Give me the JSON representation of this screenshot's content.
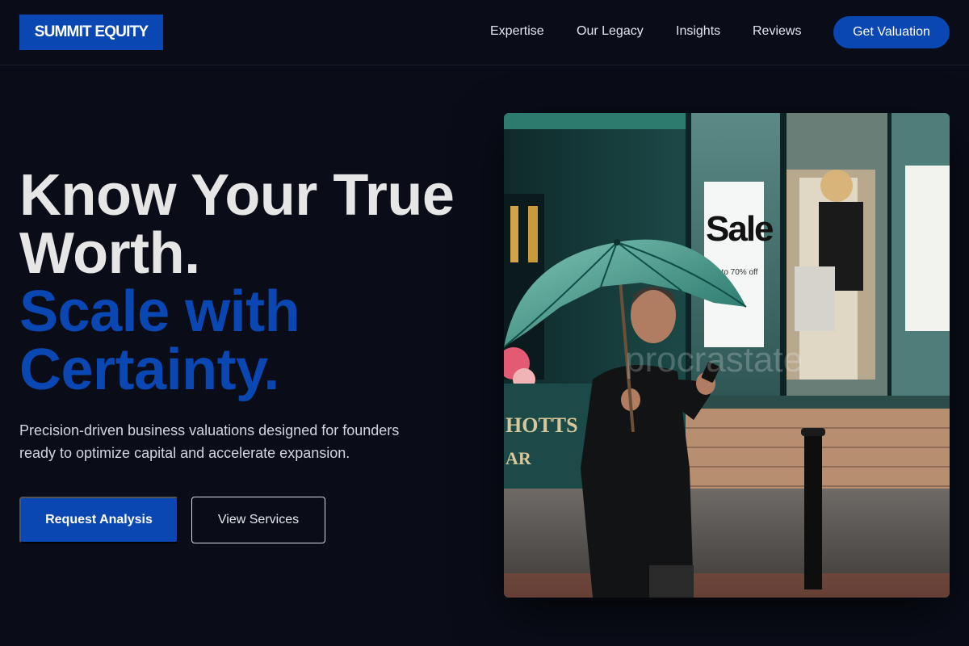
{
  "header": {
    "logo": "SUMMIT EQUITY",
    "nav": [
      {
        "label": "Expertise"
      },
      {
        "label": "Our Legacy"
      },
      {
        "label": "Insights"
      },
      {
        "label": "Reviews"
      }
    ],
    "cta": "Get Valuation"
  },
  "hero": {
    "title_line1": "Know Your True",
    "title_line2": "Worth.",
    "accent_line1": "Scale with",
    "accent_line2": "Certainty.",
    "subtitle_line1": "Precision-driven business valuations designed for founders",
    "subtitle_line2": "ready to optimize capital and accelerate expansion.",
    "primary_button": "Request Analysis",
    "secondary_button": "View Services"
  },
  "photo": {
    "sign_text": "Sale",
    "sign_subtext": "Up to 70% off",
    "shop_letters": "HOTTS",
    "shop_letters2": "AR",
    "watermark": "procrastate"
  },
  "colors": {
    "background": "#0a0d18",
    "accent": "#0a47b3",
    "text": "#e6e6e6"
  }
}
